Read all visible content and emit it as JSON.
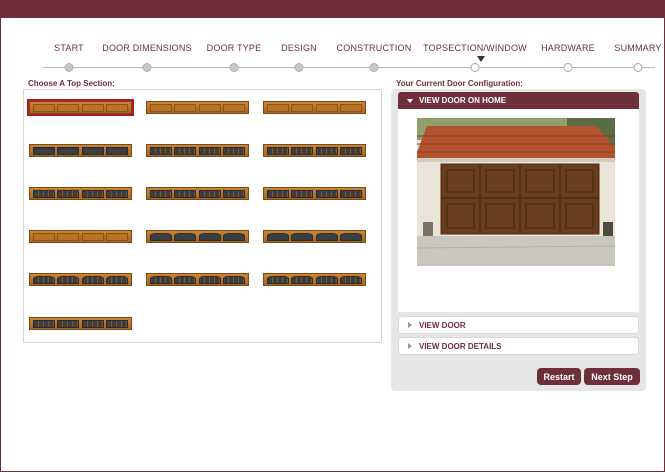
{
  "steps": [
    {
      "label": "START",
      "state": "done"
    },
    {
      "label": "DOOR DIMENSIONS",
      "state": "done"
    },
    {
      "label": "DOOR TYPE",
      "state": "done"
    },
    {
      "label": "DESIGN",
      "state": "done"
    },
    {
      "label": "CONSTRUCTION",
      "state": "done"
    },
    {
      "label": "TOPSECTION/WINDOW",
      "state": "current"
    },
    {
      "label": "HARDWARE",
      "state": "future"
    },
    {
      "label": "SUMMARY",
      "state": "future"
    }
  ],
  "left": {
    "title": "Choose A Top Section:",
    "selected_index": 0
  },
  "right": {
    "title": "Your Current Door Configuration:",
    "view_on_home_label": "VIEW DOOR ON HOME",
    "view_door_label": "VIEW DOOR",
    "view_details_label": "VIEW DOOR DETAILS"
  },
  "buttons": {
    "restart": "Restart",
    "next": "Next Step"
  },
  "colors": {
    "brand": "#6e2f3a",
    "wood": "#b87328",
    "glass": "#3a3d42",
    "selected_outline": "#b0182a"
  },
  "icons": {
    "current_step": "triangle-down-icon",
    "expanded": "caret-down-icon",
    "collapsed": "caret-right-icon"
  }
}
